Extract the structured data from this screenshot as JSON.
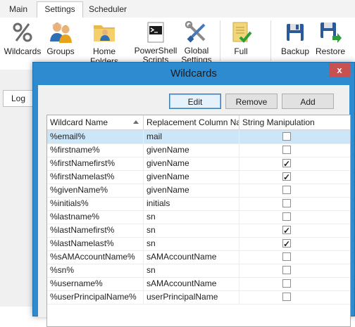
{
  "tabs": [
    {
      "label": "Main",
      "active": false
    },
    {
      "label": "Settings",
      "active": true
    },
    {
      "label": "Scheduler",
      "active": false
    }
  ],
  "ribbon": [
    {
      "label": "Wildcards",
      "icon": "percent-icon"
    },
    {
      "label": "Groups",
      "icon": "users-icon"
    },
    {
      "label": "Home Folders",
      "icon": "folder-user-icon"
    },
    {
      "label": "PowerShell Scripts",
      "icon": "powershell-icon"
    },
    {
      "label": "Global Settings",
      "icon": "tools-icon"
    },
    {
      "label": "Full",
      "icon": "checklist-icon"
    },
    {
      "label": "Backup",
      "icon": "floppy-icon"
    },
    {
      "label": "Restore",
      "icon": "floppy-restore-icon"
    }
  ],
  "log_tab": "Log",
  "dialog": {
    "title": "Wildcards",
    "close_label": "x",
    "buttons": {
      "edit": "Edit",
      "remove": "Remove",
      "add": "Add"
    },
    "columns": [
      "Wildcard Name",
      "Replacement Column Na...",
      "String Manipulation"
    ],
    "rows": [
      {
        "name": "%email%",
        "replacement": "mail",
        "string_manipulation": false,
        "selected": true
      },
      {
        "name": "%firstname%",
        "replacement": "givenName",
        "string_manipulation": false
      },
      {
        "name": "%firstNamefirst%",
        "replacement": "givenName",
        "string_manipulation": true
      },
      {
        "name": "%firstNamelast%",
        "replacement": "givenName",
        "string_manipulation": true
      },
      {
        "name": "%givenName%",
        "replacement": "givenName",
        "string_manipulation": false
      },
      {
        "name": "%initials%",
        "replacement": "initials",
        "string_manipulation": false
      },
      {
        "name": "%lastname%",
        "replacement": "sn",
        "string_manipulation": false
      },
      {
        "name": "%lastNamefirst%",
        "replacement": "sn",
        "string_manipulation": true
      },
      {
        "name": "%lastNamelast%",
        "replacement": "sn",
        "string_manipulation": true
      },
      {
        "name": "%sAMAccountName%",
        "replacement": "sAMAccountName",
        "string_manipulation": false
      },
      {
        "name": "%sn%",
        "replacement": "sn",
        "string_manipulation": false
      },
      {
        "name": "%username%",
        "replacement": "sAMAccountName",
        "string_manipulation": false
      },
      {
        "name": "%userPrincipalName%",
        "replacement": "userPrincipalName",
        "string_manipulation": false
      }
    ]
  },
  "colors": {
    "title_bar": "#2e8bd0",
    "close_button": "#c75050",
    "selected_row": "#cde6f7"
  }
}
